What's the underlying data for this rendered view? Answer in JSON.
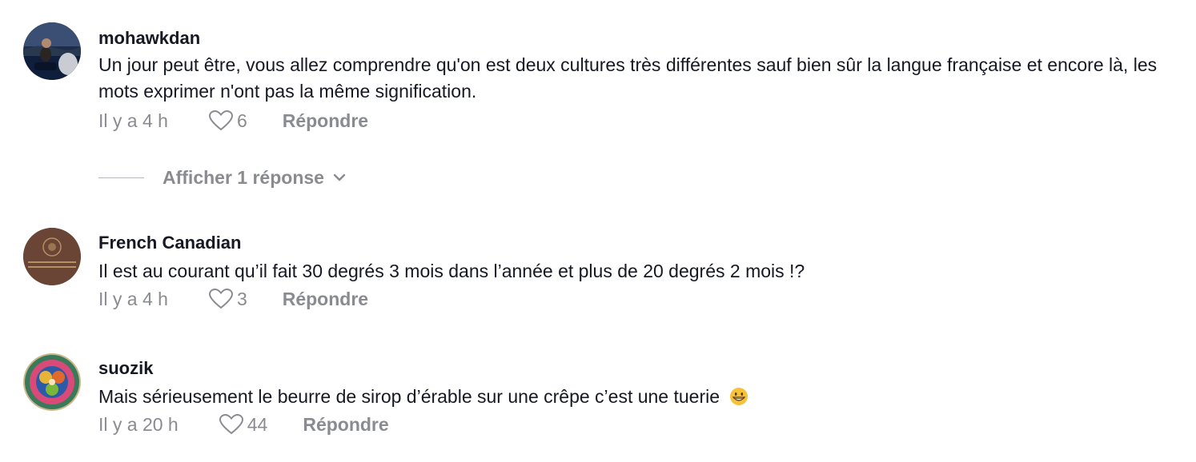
{
  "comments": [
    {
      "username": "mohawkdan",
      "text": "Un jour peut être, vous allez comprendre qu'on est deux cultures très différentes sauf bien sûr la langue française et encore là, les mots exprimer n'ont pas la même signification.",
      "time": "Il y a 4 h",
      "likes": "6",
      "reply_label": "Répondre",
      "avatar_icon": "landscape-photo-avatar"
    },
    {
      "username": "French Canadian",
      "text": "Il est au courant qu’il fait 30 degrés 3 mois dans l’année et plus de 20 degrés 2 mois !?",
      "time": "Il y a 4 h",
      "likes": "3",
      "reply_label": "Répondre",
      "avatar_icon": "passport-cover-avatar"
    },
    {
      "username": "suozik",
      "text": "Mais sérieusement le beurre de sirop d’érable sur une crêpe c’est une tuerie",
      "emoji": "grinning-face-emoji",
      "time": "Il y a 20 h",
      "likes": "44",
      "reply_label": "Répondre",
      "avatar_icon": "celtic-triskele-avatar"
    }
  ],
  "replies_toggle": {
    "label": "Afficher 1 réponse",
    "icon": "chevron-down-icon"
  },
  "colors": {
    "text": "#161823",
    "muted": "#8a8b91"
  }
}
